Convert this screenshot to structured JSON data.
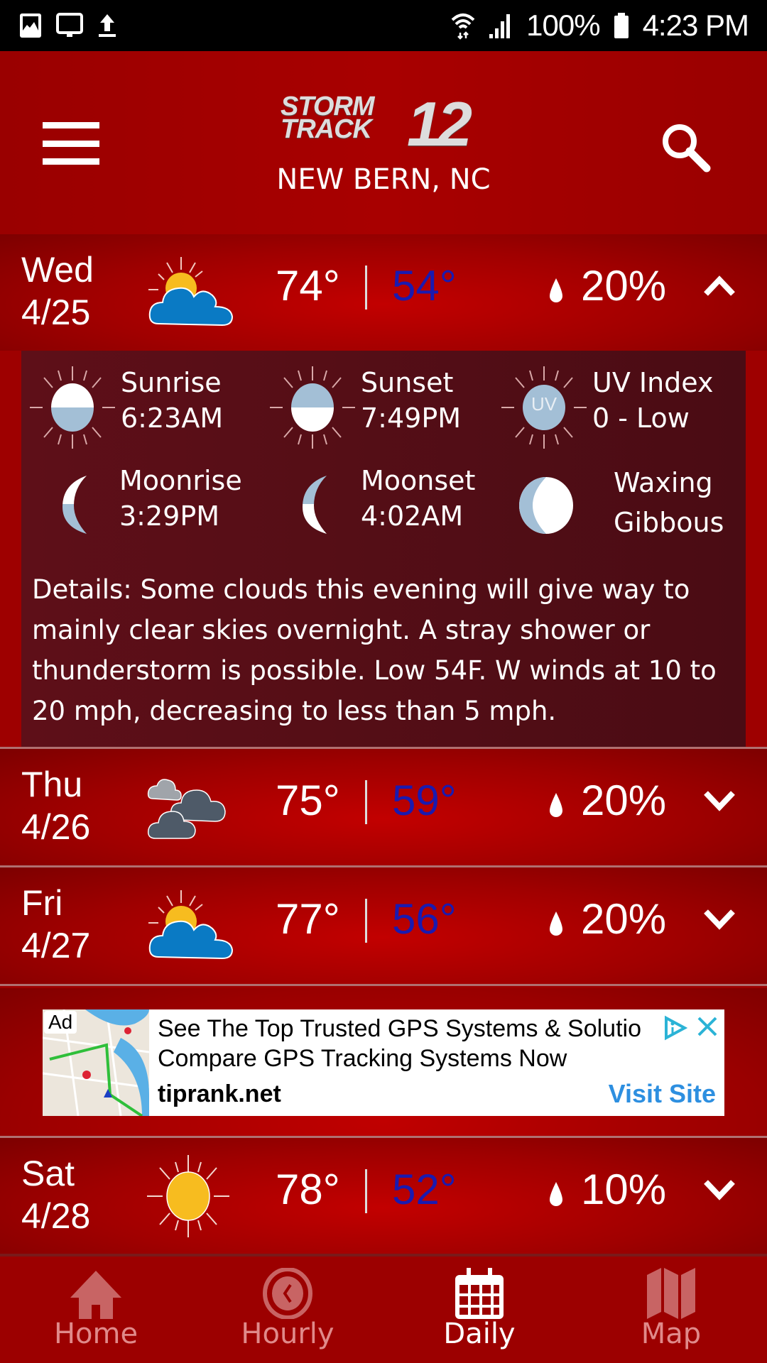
{
  "status_bar": {
    "left_icons": [
      "gallery-icon",
      "screen-cast-icon",
      "upload-icon"
    ],
    "wifi": "wifi-icon",
    "signal": "signal-icon",
    "battery_percent": "100%",
    "time": "4:23 PM"
  },
  "header": {
    "logo_line1": "STORM",
    "logo_line2": "TRACK",
    "logo_number": "12",
    "location": "NEW BERN, NC",
    "menu_icon": "hamburger-menu-icon",
    "search_icon": "search-icon"
  },
  "colors": {
    "brand_red": "#9e0000",
    "low_temp_blue": "#1a1ab0",
    "ad_cta_blue": "#2d8fe0",
    "nav_inactive": "#e08a8a"
  },
  "days": [
    {
      "day": "Wed",
      "date": "4/25",
      "condition_icon": "partly-cloudy-icon",
      "high": "74°",
      "low": "54°",
      "precip": "20%",
      "expanded": true,
      "details": {
        "sunrise_label": "Sunrise",
        "sunrise": "6:23AM",
        "sunset_label": "Sunset",
        "sunset": "7:49PM",
        "uv_label": "UV Index",
        "uv": "0 - Low",
        "uv_badge": "UV",
        "moonrise_label": "Moonrise",
        "moonrise": "3:29PM",
        "moonset_label": "Moonset",
        "moonset": "4:02AM",
        "moon_phase_line1": "Waxing",
        "moon_phase_line2": "Gibbous",
        "text": "Details: Some clouds this evening will give way to mainly clear skies overnight. A stray shower or thunderstorm is possible. Low 54F. W winds at 10 to 20 mph, decreasing to less than 5 mph."
      }
    },
    {
      "day": "Thu",
      "date": "4/26",
      "condition_icon": "cloudy-icon",
      "high": "75°",
      "low": "59°",
      "precip": "20%",
      "expanded": false
    },
    {
      "day": "Fri",
      "date": "4/27",
      "condition_icon": "partly-cloudy-icon",
      "high": "77°",
      "low": "56°",
      "precip": "20%",
      "expanded": false
    },
    {
      "day": "Sat",
      "date": "4/28",
      "condition_icon": "sunny-icon",
      "high": "78°",
      "low": "52°",
      "precip": "10%",
      "expanded": false
    }
  ],
  "ad": {
    "badge": "Ad",
    "headline": "See The Top Trusted GPS Systems & Solutio",
    "subline": "Compare GPS Tracking Systems Now",
    "domain": "tiprank.net",
    "cta": "Visit Site"
  },
  "bottom_nav": [
    {
      "label": "Home",
      "icon": "home-icon",
      "active": false
    },
    {
      "label": "Hourly",
      "icon": "clock-icon",
      "active": false
    },
    {
      "label": "Daily",
      "icon": "calendar-icon",
      "active": true
    },
    {
      "label": "Map",
      "icon": "map-icon",
      "active": false
    }
  ]
}
